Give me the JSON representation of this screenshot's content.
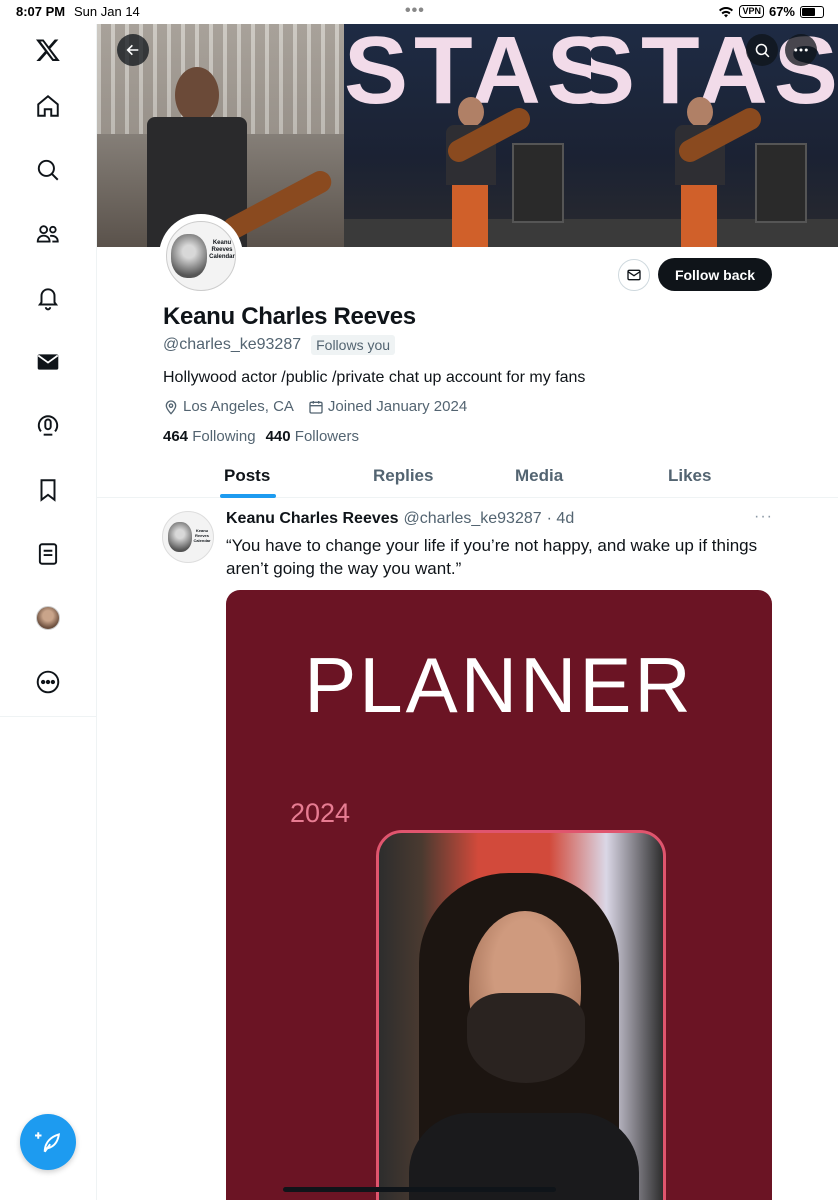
{
  "status_bar": {
    "time": "8:07 PM",
    "date": "Sun Jan 14",
    "vpn": "VPN",
    "battery": "67%",
    "battery_level": 0.67
  },
  "sidebar": {
    "items": [
      {
        "name": "x-logo-icon"
      },
      {
        "name": "home-icon"
      },
      {
        "name": "search-icon"
      },
      {
        "name": "communities-icon"
      },
      {
        "name": "notifications-icon"
      },
      {
        "name": "messages-icon"
      },
      {
        "name": "spaces-icon"
      },
      {
        "name": "bookmarks-icon"
      },
      {
        "name": "lists-icon"
      },
      {
        "name": "profile-avatar-icon"
      },
      {
        "name": "more-icon"
      }
    ],
    "compose_icon": "compose-icon"
  },
  "banner": {
    "text": "STASTA"
  },
  "profile": {
    "avatar_text": "Keanu Reeves Calendar",
    "follow_button": "Follow back",
    "name": "Keanu Charles Reeves",
    "handle": "@charles_ke93287",
    "follows_you": "Follows you",
    "bio": "Hollywood actor /public /private chat up account for my fans",
    "location": "Los Angeles, CA",
    "joined": "Joined January 2024",
    "following_count": "464",
    "following_label": "Following",
    "followers_count": "440",
    "followers_label": "Followers"
  },
  "tabs": [
    {
      "label": "Posts",
      "active": true
    },
    {
      "label": "Replies",
      "active": false
    },
    {
      "label": "Media",
      "active": false
    },
    {
      "label": "Likes",
      "active": false
    }
  ],
  "tweet": {
    "avatar_text": "Keanu Reeves Calendar",
    "name": "Keanu Charles Reeves",
    "handle": "@charles_ke93287",
    "time": "· 4d",
    "more": "···",
    "text": "“You have to change your life if you’re not happy, and wake up if things aren’t going the way you want.”",
    "image": {
      "title": "PLANNER",
      "year": "2024"
    }
  },
  "colors": {
    "accent": "#1d9bf0",
    "text": "#0f1419",
    "muted": "#536471",
    "planner_bg": "#6b1424"
  }
}
